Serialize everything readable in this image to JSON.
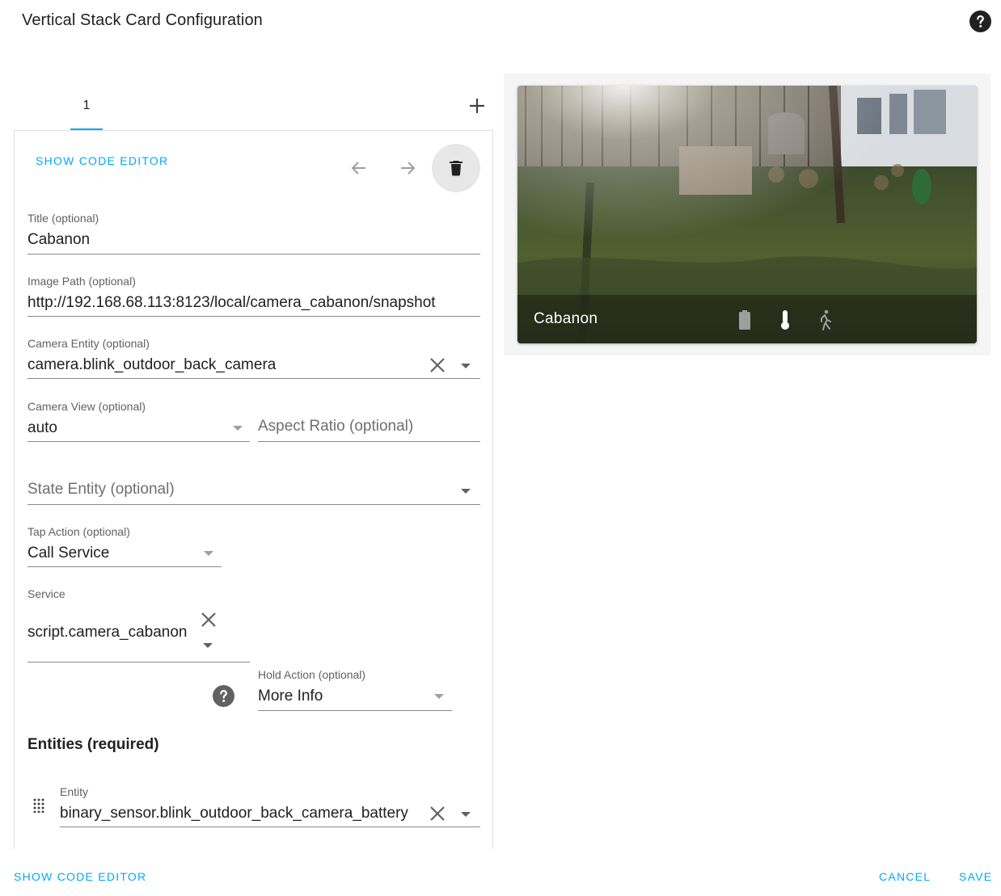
{
  "dialog": {
    "title": "Vertical Stack Card Configuration",
    "help_icon": "help-circle-icon"
  },
  "tabs": [
    {
      "label": "1",
      "active": true
    }
  ],
  "add_tab_icon": "plus-icon",
  "editor": {
    "show_code_editor": "SHOW CODE EDITOR",
    "move_left_icon": "arrow-left-icon",
    "move_right_icon": "arrow-right-icon",
    "delete_icon": "trash-icon",
    "fields": {
      "title": {
        "label": "Title (optional)",
        "value": "Cabanon"
      },
      "image_path": {
        "label": "Image Path (optional)",
        "value": "http://192.168.68.113:8123/local/camera_cabanon/snapshot"
      },
      "camera_entity": {
        "label": "Camera Entity (optional)",
        "value": "camera.blink_outdoor_back_camera"
      },
      "camera_view": {
        "label": "Camera View (optional)",
        "value": "auto"
      },
      "aspect_ratio": {
        "placeholder": "Aspect Ratio (optional)"
      },
      "state_entity": {
        "placeholder": "State Entity (optional)"
      },
      "tap_action": {
        "label": "Tap Action (optional)",
        "value": "Call Service"
      },
      "service": {
        "label": "Service",
        "value": "script.camera_cabanon"
      },
      "hold_action": {
        "label": "Hold Action (optional)",
        "value": "More Info"
      }
    },
    "entities_heading": "Entities (required)",
    "entity_row": {
      "label": "Entity",
      "value": "binary_sensor.blink_outdoor_back_camera_battery"
    }
  },
  "preview": {
    "card_title": "Cabanon",
    "icons": [
      "battery-icon",
      "thermometer-icon",
      "motion-icon"
    ]
  },
  "footer": {
    "show_code_editor": "SHOW CODE EDITOR",
    "cancel": "CANCEL",
    "save": "SAVE"
  },
  "colors": {
    "accent": "#03a9f4",
    "text": "#212121",
    "secondary_text": "#616161",
    "divider": "#e0e0e0"
  }
}
